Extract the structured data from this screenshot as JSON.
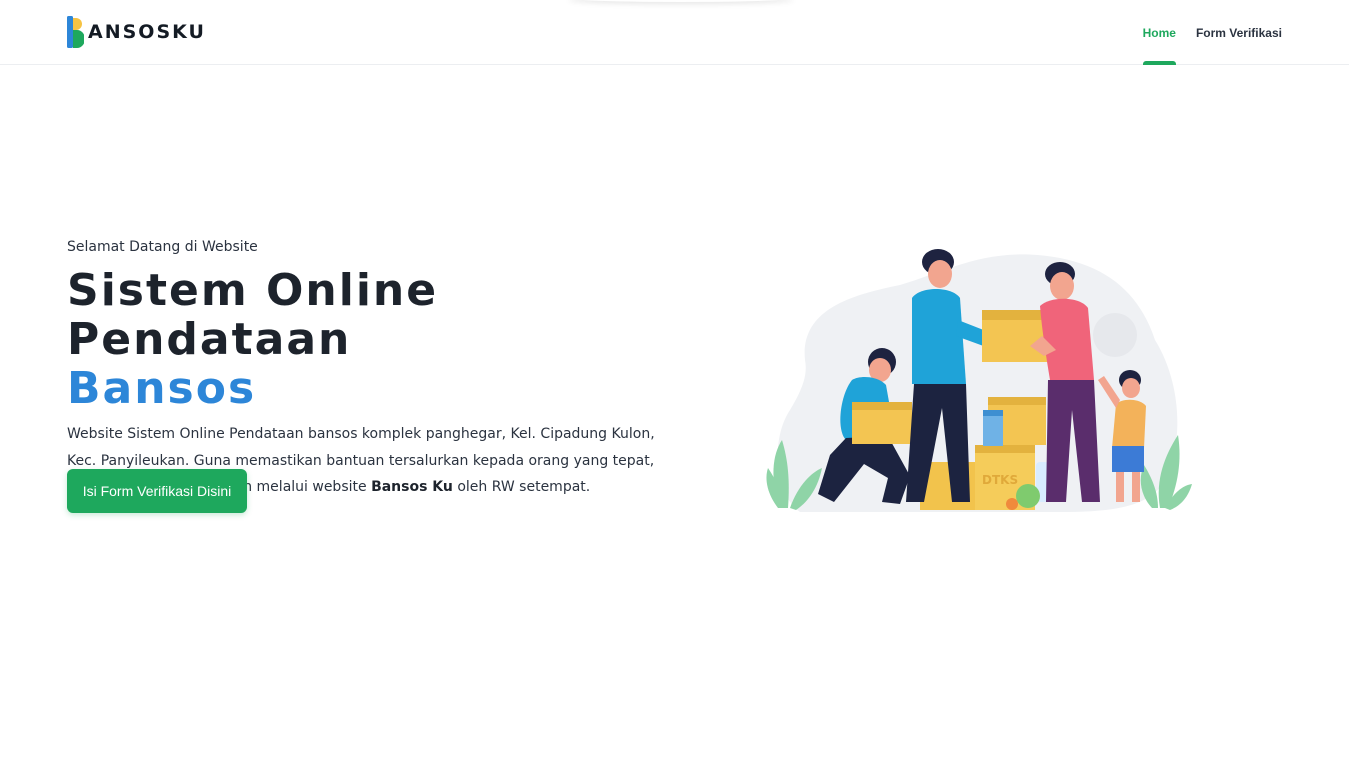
{
  "brand": {
    "name": "ANSOSKU",
    "accent_blue": "#2d86d8",
    "accent_yellow": "#f6c343",
    "accent_green": "#1ea85d"
  },
  "nav": {
    "items": [
      {
        "label": "Home",
        "active": true
      },
      {
        "label": "Form Verifikasi",
        "active": false
      }
    ]
  },
  "hero": {
    "welcome": "Selamat Datang di Website",
    "title_line1": "Sistem Online Pendataan",
    "title_line2": "Bansos",
    "description_pre": "Website Sistem Online Pendataan bansos komplek panghegar, Kel. Cipadung Kulon, Kec. Panyileukan. Guna memastikan bantuan tersalurkan kepada orang yang tepat, proses verifikasi dilakukan melalui website ",
    "description_bold": "Bansos Ku",
    "description_post": " oleh RW setempat.",
    "cta_label": "Isi Form Verifikasi Disini"
  },
  "illustration": {
    "icon": "aid-distribution-illustration",
    "box_label": "DTKS"
  }
}
